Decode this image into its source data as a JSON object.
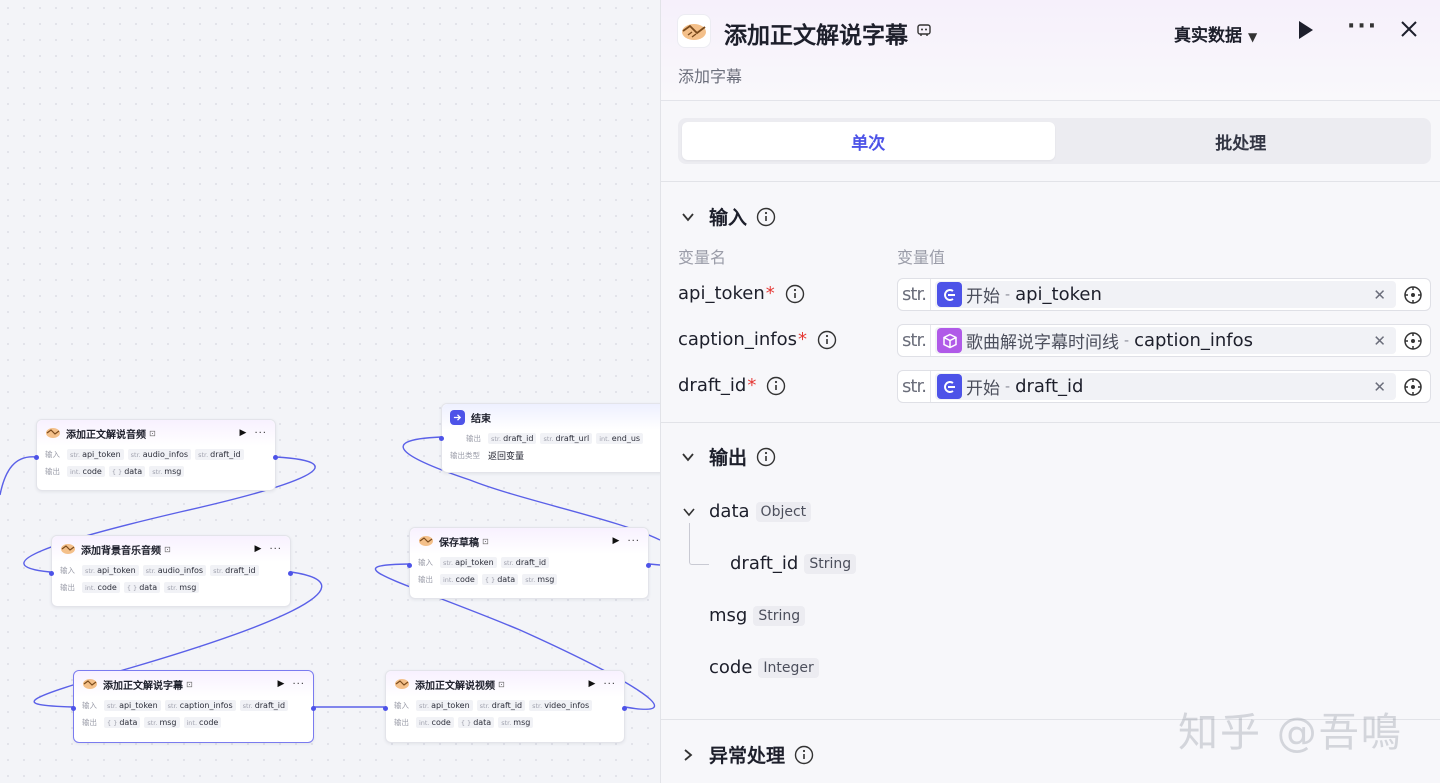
{
  "canvas": {
    "nodes": {
      "audio": {
        "title": "添加正文解说音频",
        "in_label": "输入",
        "out_label": "输出",
        "inputs": [
          {
            "t": "str.",
            "n": "api_token"
          },
          {
            "t": "str.",
            "n": "audio_infos"
          },
          {
            "t": "str.",
            "n": "draft_id"
          }
        ],
        "outputs": [
          {
            "t": "int.",
            "n": "code"
          },
          {
            "t": "{ }",
            "n": "data"
          },
          {
            "t": "str.",
            "n": "msg"
          }
        ]
      },
      "bgm": {
        "title": "添加背景音乐音频",
        "in_label": "输入",
        "out_label": "输出",
        "inputs": [
          {
            "t": "str.",
            "n": "api_token"
          },
          {
            "t": "str.",
            "n": "audio_infos"
          },
          {
            "t": "str.",
            "n": "draft_id"
          }
        ],
        "outputs": [
          {
            "t": "int.",
            "n": "code"
          },
          {
            "t": "{ }",
            "n": "data"
          },
          {
            "t": "str.",
            "n": "msg"
          }
        ]
      },
      "caption": {
        "title": "添加正文解说字幕",
        "in_label": "输入",
        "out_label": "输出",
        "inputs": [
          {
            "t": "str.",
            "n": "api_token"
          },
          {
            "t": "str.",
            "n": "caption_infos"
          },
          {
            "t": "str.",
            "n": "draft_id"
          }
        ],
        "outputs": [
          {
            "t": "{ }",
            "n": "data"
          },
          {
            "t": "str.",
            "n": "msg"
          },
          {
            "t": "int.",
            "n": "code"
          }
        ]
      },
      "end": {
        "title": "结束",
        "out_label": "输出",
        "type_label": "输出类型",
        "type_value": "返回变量",
        "outputs": [
          {
            "t": "str.",
            "n": "draft_id"
          },
          {
            "t": "str.",
            "n": "draft_url"
          },
          {
            "t": "int.",
            "n": "end_us"
          }
        ]
      },
      "save": {
        "title": "保存草稿",
        "in_label": "输入",
        "out_label": "输出",
        "inputs": [
          {
            "t": "str.",
            "n": "api_token"
          },
          {
            "t": "str.",
            "n": "draft_id"
          }
        ],
        "outputs": [
          {
            "t": "int.",
            "n": "code"
          },
          {
            "t": "{ }",
            "n": "data"
          },
          {
            "t": "str.",
            "n": "msg"
          }
        ]
      },
      "video": {
        "title": "添加正文解说视频",
        "in_label": "输入",
        "out_label": "输出",
        "inputs": [
          {
            "t": "str.",
            "n": "api_token"
          },
          {
            "t": "str.",
            "n": "draft_id"
          },
          {
            "t": "str.",
            "n": "video_infos"
          }
        ],
        "outputs": [
          {
            "t": "int.",
            "n": "code"
          },
          {
            "t": "{ }",
            "n": "data"
          },
          {
            "t": "str.",
            "n": "msg"
          }
        ]
      }
    },
    "edge_color": "#4d53e8"
  },
  "panel": {
    "title": "添加正文解说字幕",
    "subtitle": "添加字幕",
    "data_select": "真实数据",
    "tabs": [
      "单次",
      "批处理"
    ],
    "input_section": "输入",
    "col_name": "变量名",
    "col_value": "变量值",
    "inputs": [
      {
        "name": "api_token",
        "required": "*",
        "type": "str.",
        "source_node": "开始",
        "sep": "-",
        "source_var": "api_token",
        "icon_color": "#4d53e8"
      },
      {
        "name": "caption_infos",
        "required": "*",
        "type": "str.",
        "source_node": "歌曲解说字幕时间线",
        "sep": "-",
        "source_var": "caption_infos",
        "icon_color": "#b05ae8"
      },
      {
        "name": "draft_id",
        "required": "*",
        "type": "str.",
        "source_node": "开始",
        "sep": "-",
        "source_var": "draft_id",
        "icon_color": "#4d53e8"
      }
    ],
    "output_section": "输出",
    "outputs": [
      {
        "name": "data",
        "type": "Object"
      },
      {
        "name": "draft_id",
        "type": "String"
      },
      {
        "name": "msg",
        "type": "String"
      },
      {
        "name": "code",
        "type": "Integer"
      }
    ],
    "error_section": "异常处理",
    "accent": "#4d53e8"
  },
  "watermark": "知乎 @吾鳴"
}
